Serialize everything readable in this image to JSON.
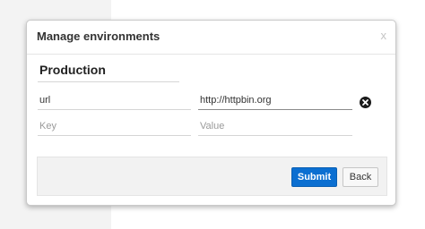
{
  "modal": {
    "title": "Manage environments",
    "close_label": "x"
  },
  "environment": {
    "name": "Production"
  },
  "rows": [
    {
      "key": "url",
      "value": "http://httpbin.org"
    },
    {
      "key_placeholder": "Key",
      "value_placeholder": "Value"
    }
  ],
  "footer": {
    "submit_label": "Submit",
    "back_label": "Back"
  },
  "colors": {
    "primary": "#0b6fd1",
    "delete_icon": "#1a1a1a"
  },
  "icons": {
    "close": "close-icon",
    "delete_row": "remove-circle-icon"
  }
}
